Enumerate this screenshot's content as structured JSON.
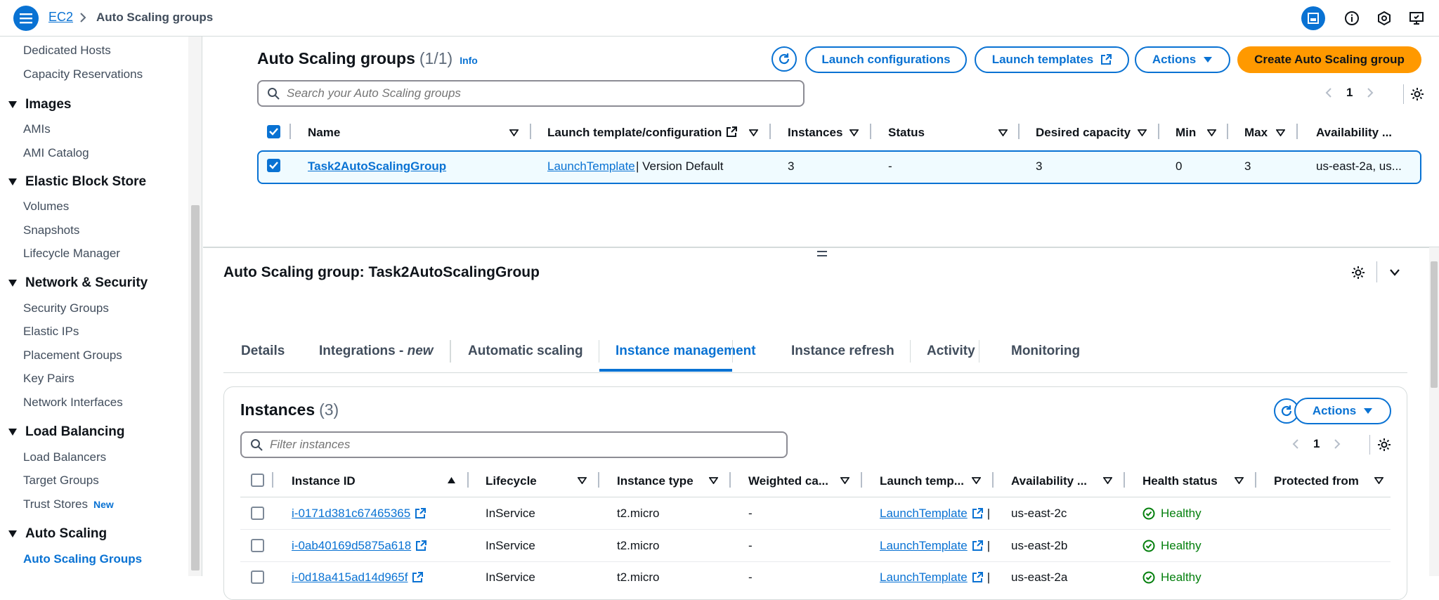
{
  "topbar": {
    "breadcrumb_root": "EC2",
    "breadcrumb_current": "Auto Scaling groups"
  },
  "sidebar": {
    "items_top": [
      "Dedicated Hosts",
      "Capacity Reservations"
    ],
    "sections": [
      {
        "title": "Images",
        "items": [
          "AMIs",
          "AMI Catalog"
        ]
      },
      {
        "title": "Elastic Block Store",
        "items": [
          "Volumes",
          "Snapshots",
          "Lifecycle Manager"
        ]
      },
      {
        "title": "Network & Security",
        "items": [
          "Security Groups",
          "Elastic IPs",
          "Placement Groups",
          "Key Pairs",
          "Network Interfaces"
        ]
      },
      {
        "title": "Load Balancing",
        "items": [
          "Load Balancers",
          "Target Groups",
          "Trust Stores"
        ]
      },
      {
        "title": "Auto Scaling",
        "items": [
          "Auto Scaling Groups"
        ]
      }
    ],
    "new_badge": "New"
  },
  "asg": {
    "title": "Auto Scaling groups",
    "count": "(1/1)",
    "info": "Info",
    "btn_launch_configs": "Launch configurations",
    "btn_launch_templates": "Launch templates",
    "btn_actions": "Actions",
    "btn_create": "Create Auto Scaling group",
    "search_placeholder": "Search your Auto Scaling groups",
    "page": "1",
    "columns": [
      "Name",
      "Launch template/configuration",
      "Instances",
      "Status",
      "Desired capacity",
      "Min",
      "Max",
      "Availability ..."
    ],
    "row": {
      "name": "Task2AutoScalingGroup",
      "template_link": "LaunchTemplate",
      "template_rest": "| Version Default",
      "instances": "3",
      "status": "-",
      "desired": "3",
      "min": "0",
      "max": "3",
      "az": "us-east-2a, us..."
    }
  },
  "detail": {
    "title": "Auto Scaling group: Task2AutoScalingGroup",
    "tabs": [
      "Details",
      "Integrations - ",
      "Automatic scaling",
      "Instance management",
      "Instance refresh",
      "Activity",
      "Monitoring"
    ],
    "tab_new": "new",
    "active_tab": "Instance management"
  },
  "instances": {
    "title": "Instances",
    "count": "(3)",
    "btn_actions": "Actions",
    "filter_placeholder": "Filter instances",
    "page": "1",
    "columns": [
      "Instance ID",
      "Lifecycle",
      "Instance type",
      "Weighted ca...",
      "Launch temp...",
      "Availability ...",
      "Health status",
      "Protected from"
    ],
    "rows": [
      {
        "id": "i-0171d381c67465365",
        "lifecycle": "InService",
        "type": "t2.micro",
        "weighted": "-",
        "template": "LaunchTemplate",
        "az": "us-east-2c",
        "health": "Healthy"
      },
      {
        "id": "i-0ab40169d5875a618",
        "lifecycle": "InService",
        "type": "t2.micro",
        "weighted": "-",
        "template": "LaunchTemplate",
        "az": "us-east-2b",
        "health": "Healthy"
      },
      {
        "id": "i-0d18a415ad14d965f",
        "lifecycle": "InService",
        "type": "t2.micro",
        "weighted": "-",
        "template": "LaunchTemplate",
        "az": "us-east-2a",
        "health": "Healthy"
      }
    ]
  },
  "colors": {
    "accent": "#0972d3",
    "primary": "#ff9900",
    "success": "#037f0c"
  }
}
